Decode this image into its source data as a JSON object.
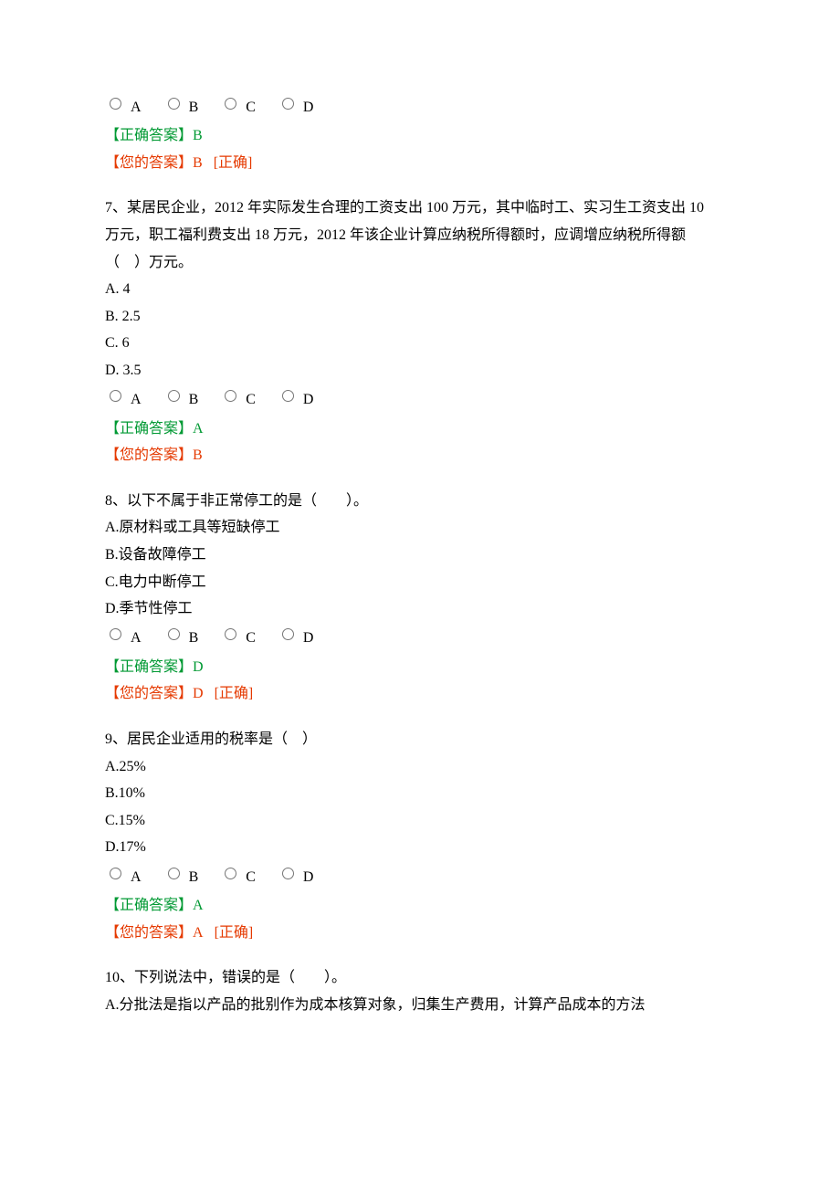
{
  "labels": {
    "correct_answer_prefix": "【正确答案】",
    "your_answer_prefix": "【您的答案】",
    "correct_tag": "[正确]"
  },
  "radio_letters": [
    "A",
    "B",
    "C",
    "D"
  ],
  "q6": {
    "correct": "B",
    "your": "B",
    "is_correct": true
  },
  "q7": {
    "text": "7、某居民企业，2012 年实际发生合理的工资支出 100 万元，其中临时工、实习生工资支出 10",
    "text2": "万元，职工福利费支出 18 万元，2012 年该企业计算应纳税所得额时，应调增应纳税所得额",
    "text3": "（　）万元。",
    "opts": {
      "A": "A. 4",
      "B": "B. 2.5",
      "C": "C. 6",
      "D": "D. 3.5"
    },
    "correct": "A",
    "your": "B",
    "is_correct": false
  },
  "q8": {
    "text": "8、以下不属于非正常停工的是（　　）。",
    "opts": {
      "A": "A.原材料或工具等短缺停工",
      "B": "B.设备故障停工",
      "C": "C.电力中断停工",
      "D": "D.季节性停工"
    },
    "correct": "D",
    "your": "D",
    "is_correct": true
  },
  "q9": {
    "text": "9、居民企业适用的税率是（　）",
    "opts": {
      "A": "A.25%",
      "B": "B.10%",
      "C": "C.15%",
      "D": "D.17%"
    },
    "correct": "A",
    "your": "A",
    "is_correct": true
  },
  "q10": {
    "text": "10、下列说法中，错误的是（　　）。",
    "opts": {
      "A": "A.分批法是指以产品的批别作为成本核算对象，归集生产费用，计算产品成本的方法"
    }
  }
}
